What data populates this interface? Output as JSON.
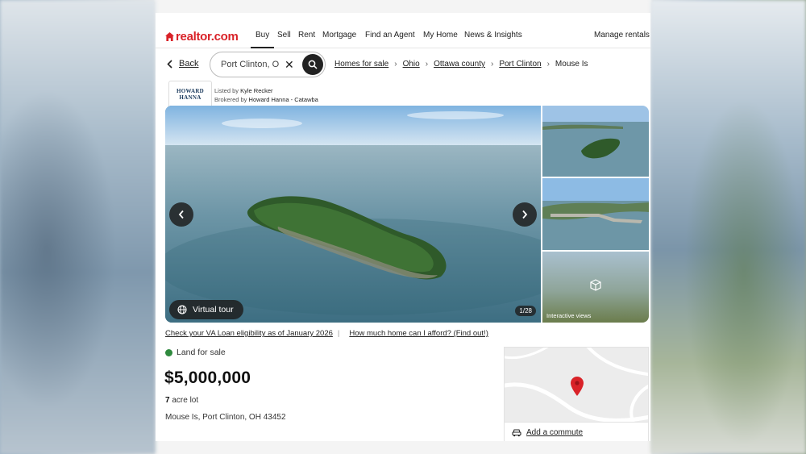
{
  "brand": {
    "name": "realtor.com",
    "color": "#d92228"
  },
  "nav": {
    "items": [
      "Buy",
      "Sell",
      "Rent",
      "Mortgage",
      "Find an Agent",
      "My Home",
      "News & Insights"
    ],
    "active": "Buy",
    "manage_rentals": "Manage rentals"
  },
  "search": {
    "back_label": "Back",
    "value": "Port Clinton, O"
  },
  "breadcrumbs": [
    "Homes for sale",
    "Ohio",
    "Ottawa county",
    "Port Clinton",
    "Mouse Is"
  ],
  "broker": {
    "logo_line1": "HOWARD",
    "logo_line2": "HANNA",
    "listed_by_prefix": "Listed by",
    "listed_by": "Kyle Recker",
    "brokered_by_prefix": "Brokered by",
    "brokered_by": "Howard Hanna - Catawba"
  },
  "gallery": {
    "virtual_tour_label": "Virtual tour",
    "photo_counter": "1/28",
    "interactive_views_label": "Interactive views"
  },
  "links": {
    "va_loan": "Check your VA Loan eligibility as of January 2026",
    "afford": "How much home can I afford? (Find out!)"
  },
  "listing": {
    "status": "Land for sale",
    "status_color": "#2f8a3e",
    "price": "$5,000,000",
    "lot_size_value": "7",
    "lot_size_unit": "acre lot",
    "address": "Mouse Is, Port Clinton, OH 43452"
  },
  "map": {
    "commute_label": "Add a commute",
    "pin_color": "#d92228"
  }
}
